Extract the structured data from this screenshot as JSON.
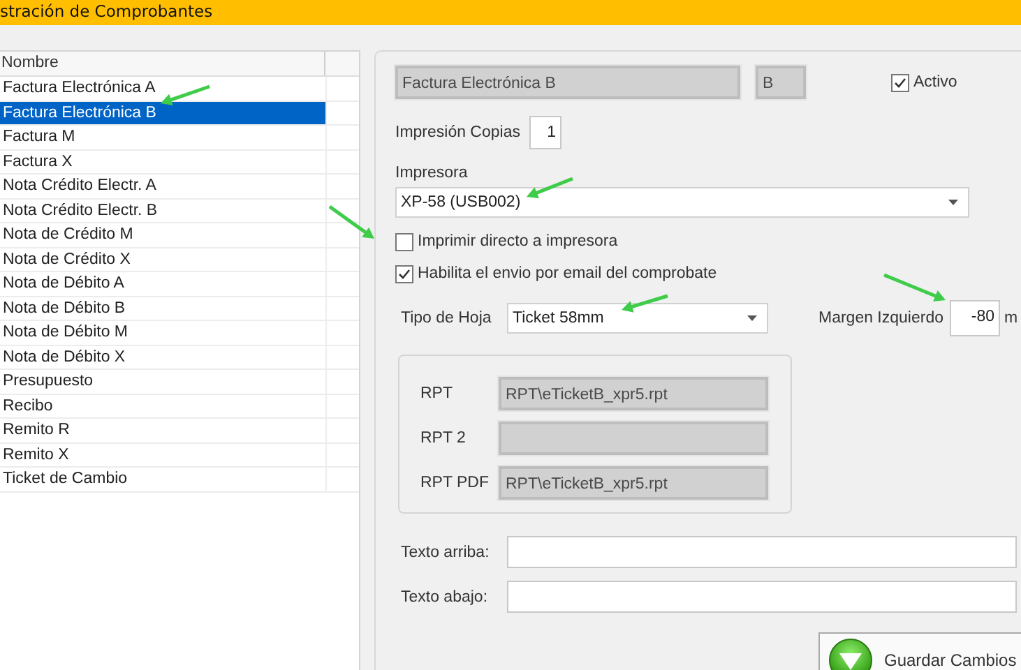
{
  "window": {
    "title": "stración de Comprobantes"
  },
  "list": {
    "columns": [
      "Nombre"
    ],
    "rows": [
      {
        "name": "Factura Electrónica A",
        "selected": false
      },
      {
        "name": "Factura Electrónica B",
        "selected": true
      },
      {
        "name": "Factura M",
        "selected": false
      },
      {
        "name": "Factura X",
        "selected": false
      },
      {
        "name": "Nota Crédito Electr. A",
        "selected": false
      },
      {
        "name": "Nota Crédito Electr. B",
        "selected": false
      },
      {
        "name": "Nota de Crédito M",
        "selected": false
      },
      {
        "name": "Nota de Crédito X",
        "selected": false
      },
      {
        "name": "Nota de Débito A",
        "selected": false
      },
      {
        "name": "Nota de Débito B",
        "selected": false
      },
      {
        "name": "Nota de Débito M",
        "selected": false
      },
      {
        "name": "Nota de Débito X",
        "selected": false
      },
      {
        "name": "Presupuesto",
        "selected": false
      },
      {
        "name": "Recibo",
        "selected": false
      },
      {
        "name": "Remito R",
        "selected": false
      },
      {
        "name": "Remito X",
        "selected": false
      },
      {
        "name": "Ticket de Cambio",
        "selected": false
      }
    ]
  },
  "form": {
    "name_field": {
      "value": "Factura Electrónica B"
    },
    "letter_field": {
      "value": "B"
    },
    "activo": {
      "label": "Activo",
      "checked": true
    },
    "copias": {
      "label": "Impresión Copias",
      "value": "1"
    },
    "impresora": {
      "label": "Impresora",
      "value": "XP-58 (USB002)"
    },
    "options": [
      {
        "label": "Imprimir directo a impresora",
        "checked": false
      },
      {
        "label": "Habilita el envio por email del comprobate",
        "checked": true
      }
    ],
    "tipo_hoja": {
      "label": "Tipo de Hoja",
      "value": "Ticket 58mm"
    },
    "margen": {
      "label": "Margen Izquierdo",
      "value": "-80",
      "unit": "m"
    },
    "reports": [
      {
        "label": "RPT",
        "value": "RPT\\eTicketB_xpr5.rpt"
      },
      {
        "label": "RPT 2"
      },
      {
        "label": "RPT PDF",
        "value": "RPT\\eTicketB_xpr5.rpt"
      }
    ],
    "texts": [
      {
        "label": "Texto arriba:"
      },
      {
        "label": "Texto abajo:"
      }
    ],
    "save_button": {
      "label": "Guardar Cambios"
    }
  }
}
